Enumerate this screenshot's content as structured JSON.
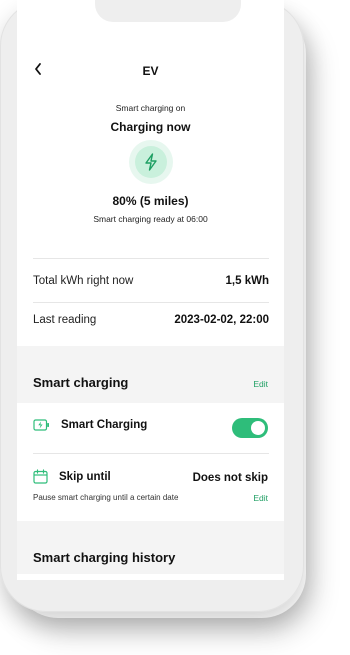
{
  "header": {
    "back_glyph": "‹",
    "title": "EV",
    "subtitle": "Smart charging on",
    "status": "Charging now",
    "battery": "80% (5 miles)",
    "ready_text": "Smart charging ready at 06:00"
  },
  "stats": [
    {
      "label": "Total kWh right now",
      "value": "1,5 kWh"
    },
    {
      "label": "Last reading",
      "value": "2023-02-02, 22:00"
    }
  ],
  "smart_charging": {
    "section_title": "Smart charging",
    "edit_label": "Edit",
    "toggle_label": "Smart Charging",
    "toggle_on": true,
    "skip_label": "Skip until",
    "skip_value": "Does not skip",
    "skip_hint": "Pause smart charging until a certain date",
    "skip_edit_label": "Edit"
  },
  "history": {
    "section_title": "Smart charging history"
  },
  "colors": {
    "accent": "#2ebd7a",
    "accent_dark": "#1e9f63",
    "bolt_bg": "#c9f0dc"
  },
  "icons": [
    "chevron-left-icon",
    "lightning-bolt-icon",
    "battery-charging-icon",
    "calendar-icon"
  ]
}
